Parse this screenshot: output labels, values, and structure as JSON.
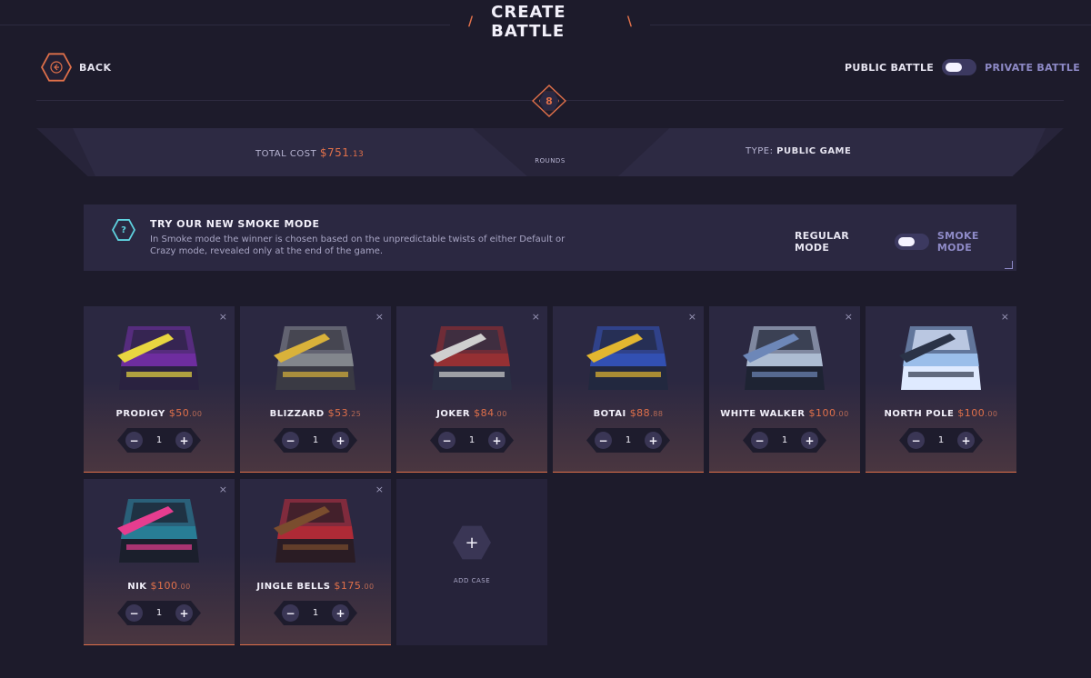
{
  "header": {
    "title": "CREATE BATTLE",
    "back_label": "BACK"
  },
  "battle_visibility": {
    "left_label": "PUBLIC BATTLE",
    "right_label": "PRIVATE BATTLE"
  },
  "rounds": {
    "value": "8",
    "label": "ROUNDS"
  },
  "stats": {
    "total_cost_label": "TOTAL COST",
    "total_cost_dollars": "$751",
    "total_cost_cents": ".13",
    "type_label": "TYPE:",
    "type_value": "PUBLIC GAME"
  },
  "smoke": {
    "title": "TRY OUR NEW SMOKE MODE",
    "description": "In Smoke mode the winner is chosen based on the unpredictable twists of either Default or Crazy mode, revealed only at the end of the game.",
    "left_label": "REGULAR MODE",
    "right_label": "SMOKE MODE"
  },
  "colors": {
    "accent": "#e0704a",
    "bg": "#1d1b2b",
    "panel": "#2b2841",
    "muted": "#8e8ac7"
  },
  "cases": [
    {
      "name": "PRODIGY",
      "price": "$50",
      "cents": ".00",
      "qty": "1",
      "art": [
        "#7a2fb0",
        "#e8d640",
        "#2a2240"
      ]
    },
    {
      "name": "BLIZZARD",
      "price": "$53",
      "cents": ".25",
      "qty": "1",
      "art": [
        "#8f9499",
        "#d9b23a",
        "#3a3a44"
      ]
    },
    {
      "name": "JOKER",
      "price": "$84",
      "cents": ".00",
      "qty": "1",
      "art": [
        "#a83030",
        "#cfcfcf",
        "#2b2f44"
      ]
    },
    {
      "name": "BOTAI",
      "price": "$88",
      "cents": ".88",
      "qty": "1",
      "art": [
        "#3557c7",
        "#e2b630",
        "#22283f"
      ]
    },
    {
      "name": "WHITE WALKER",
      "price": "$100",
      "cents": ".00",
      "qty": "1",
      "art": [
        "#c7d7ee",
        "#6d87b8",
        "#1e2333"
      ]
    },
    {
      "name": "NORTH POLE",
      "price": "$100",
      "cents": ".00",
      "qty": "1",
      "art": [
        "#8fb6e6",
        "#2b3347",
        "#dfeaff"
      ]
    },
    {
      "name": "NIK",
      "price": "$100",
      "cents": ".00",
      "qty": "1",
      "art": [
        "#2a8ea8",
        "#e63d8f",
        "#1b1f2c"
      ]
    },
    {
      "name": "JINGLE BELLS",
      "price": "$175",
      "cents": ".00",
      "qty": "1",
      "art": [
        "#c62d3a",
        "#7a4d2e",
        "#2a1c24"
      ]
    }
  ],
  "controls": {
    "minus": "−",
    "plus": "+",
    "close": "×"
  },
  "add_case": {
    "icon": "+",
    "label": "ADD CASE"
  }
}
